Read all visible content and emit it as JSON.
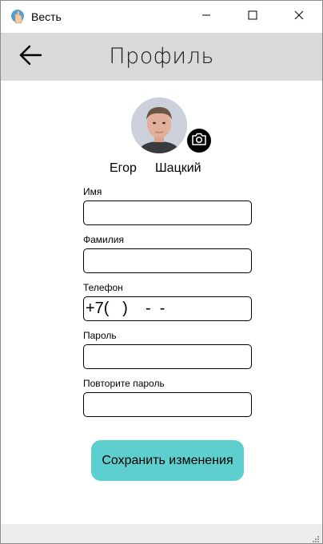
{
  "window": {
    "title": "Весть",
    "app_icon": "hand-icon",
    "controls": [
      "minimize-icon",
      "maximize-icon",
      "close-icon"
    ]
  },
  "header": {
    "back_icon": "arrow-left-icon",
    "title": "Профиль"
  },
  "profile": {
    "first_name": "Егор",
    "last_name": "Шацкий",
    "camera_icon": "camera-icon"
  },
  "form": {
    "first_name_label": "Имя",
    "first_name_value": "",
    "last_name_label": "Фамилия",
    "last_name_value": "",
    "phone_label": "Телефон",
    "phone_value": "+7(   )    -  -",
    "password_label": "Пароль",
    "password_value": "",
    "repeat_password_label": "Повторите пароль",
    "repeat_password_value": ""
  },
  "actions": {
    "save_label": "Сохранить изменения"
  },
  "colors": {
    "header_bg": "#d9d9d9",
    "save_button": "#5ecfcf",
    "footer_bg": "#ececec"
  }
}
